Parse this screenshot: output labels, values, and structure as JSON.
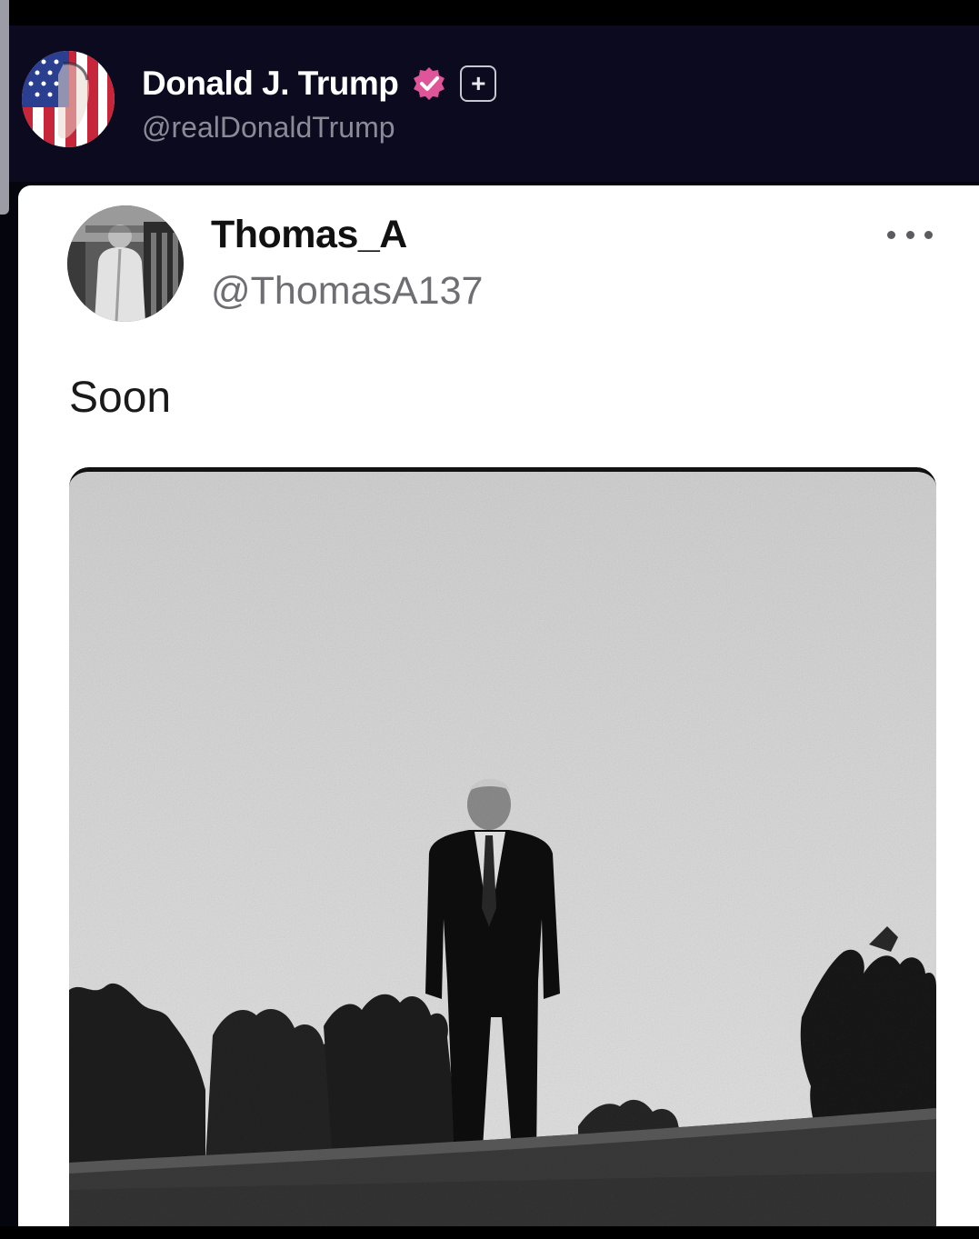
{
  "original_post": {
    "author_name": "Donald J. Trump",
    "author_handle": "@realDonaldTrump",
    "verified_icon": "verified-badge-icon",
    "plus_icon": "plus-icon",
    "verified_color": "#e0559a"
  },
  "quoted_post": {
    "author_name": "Thomas_A",
    "author_handle": "@ThomasA137",
    "text": "Soon",
    "menu_icon": "more-options-icon",
    "image_icon": "post-photo"
  },
  "colors": {
    "header_background": "#0b0a1e",
    "card_background": "#ffffff"
  }
}
